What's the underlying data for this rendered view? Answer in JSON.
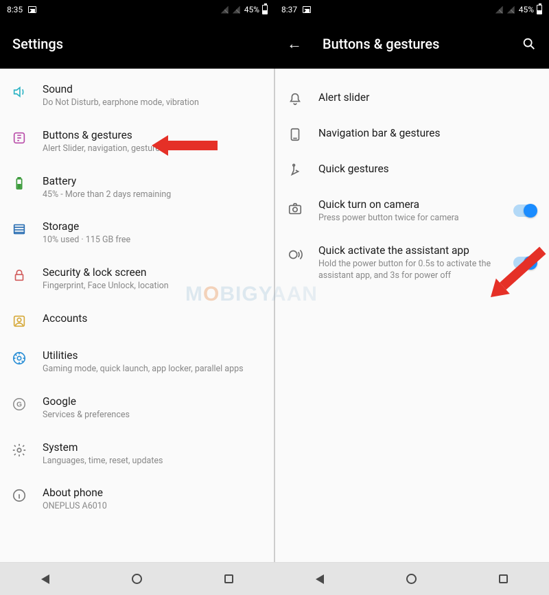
{
  "left": {
    "status": {
      "time": "8:35",
      "battery_pct": "45%"
    },
    "header": {
      "title": "Settings"
    },
    "items": [
      {
        "icon": "sound-icon",
        "title": "Sound",
        "sub": "Do Not Disturb, earphone mode, vibration"
      },
      {
        "icon": "buttons-icon",
        "title": "Buttons & gestures",
        "sub": "Alert Slider, navigation, gestures"
      },
      {
        "icon": "battery-icon",
        "title": "Battery",
        "sub": "45% - More than 2 days remaining"
      },
      {
        "icon": "storage-icon",
        "title": "Storage",
        "sub": "10% used · 115 GB free"
      },
      {
        "icon": "security-icon",
        "title": "Security & lock screen",
        "sub": "Fingerprint, Face Unlock, location"
      },
      {
        "icon": "accounts-icon",
        "title": "Accounts",
        "sub": ""
      },
      {
        "icon": "utilities-icon",
        "title": "Utilities",
        "sub": "Gaming mode, quick launch, app locker, parallel apps"
      },
      {
        "icon": "google-icon",
        "title": "Google",
        "sub": "Services & preferences"
      },
      {
        "icon": "system-icon",
        "title": "System",
        "sub": "Languages, time, reset, updates"
      },
      {
        "icon": "about-icon",
        "title": "About phone",
        "sub": "ONEPLUS A6010"
      }
    ]
  },
  "right": {
    "status": {
      "time": "8:37",
      "battery_pct": "45%"
    },
    "header": {
      "title": "Buttons & gestures"
    },
    "items": [
      {
        "icon": "alert-slider-icon",
        "title": "Alert slider",
        "sub": ""
      },
      {
        "icon": "navbar-icon",
        "title": "Navigation bar & gestures",
        "sub": ""
      },
      {
        "icon": "quick-gestures-icon",
        "title": "Quick gestures",
        "sub": ""
      },
      {
        "icon": "camera-icon",
        "title": "Quick turn on camera",
        "sub": "Press power button twice for camera",
        "toggle": true
      },
      {
        "icon": "assistant-icon",
        "title": "Quick activate the assistant app",
        "sub": "Hold the power button for 0.5s to activate the assistant app, and 3s for power off",
        "toggle": true
      }
    ]
  },
  "watermark": "MOBIGYAAN"
}
